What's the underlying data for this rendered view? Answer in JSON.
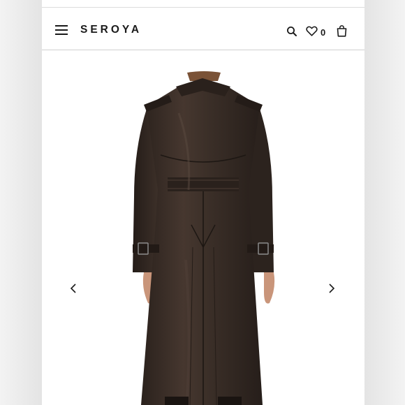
{
  "header": {
    "brand": "SEROYA",
    "wishlist_count": "0",
    "icons": {
      "menu": "hamburger-menu-icon",
      "search": "search-icon",
      "wishlist": "heart-icon",
      "cart": "shopping-bag-icon"
    }
  },
  "gallery": {
    "image": "dark-brown-leather-trench-coat-back-view",
    "prev_icon": "chevron-left-icon",
    "next_icon": "chevron-right-icon"
  },
  "colors": {
    "text": "#1a1a1a",
    "coat": "#3a2e27",
    "background": "#ffffff"
  }
}
